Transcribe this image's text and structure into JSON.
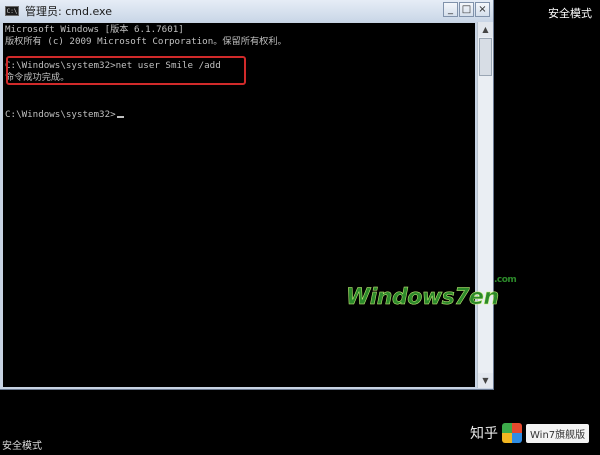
{
  "window": {
    "title": "管理员: cmd.exe",
    "icon": "cmd-icon",
    "controls": {
      "minimize": "_",
      "maximize": "□",
      "close": "×"
    }
  },
  "console": {
    "lines": [
      "Microsoft Windows [版本 6.1.7601]",
      "版权所有 (c) 2009 Microsoft Corporation。保留所有权利。",
      "",
      "C:\\Windows\\system32>net user Smile /add",
      "命令成功完成。",
      "",
      "",
      "C:\\Windows\\system32>"
    ]
  },
  "desktop": {
    "safe_mode_top_right": "安全模式",
    "safe_mode_bottom_left": "安全模式"
  },
  "watermarks": {
    "site_logo_text": "Windows7en",
    "site_logo_com": ".com",
    "zhihu_text": "知乎",
    "badge_text": "Win7旗舰版"
  },
  "colors": {
    "console_bg": "#000000",
    "console_text": "#c0c0c0",
    "highlight": "#d12a2a",
    "logo_green": "#2c8a2a"
  }
}
